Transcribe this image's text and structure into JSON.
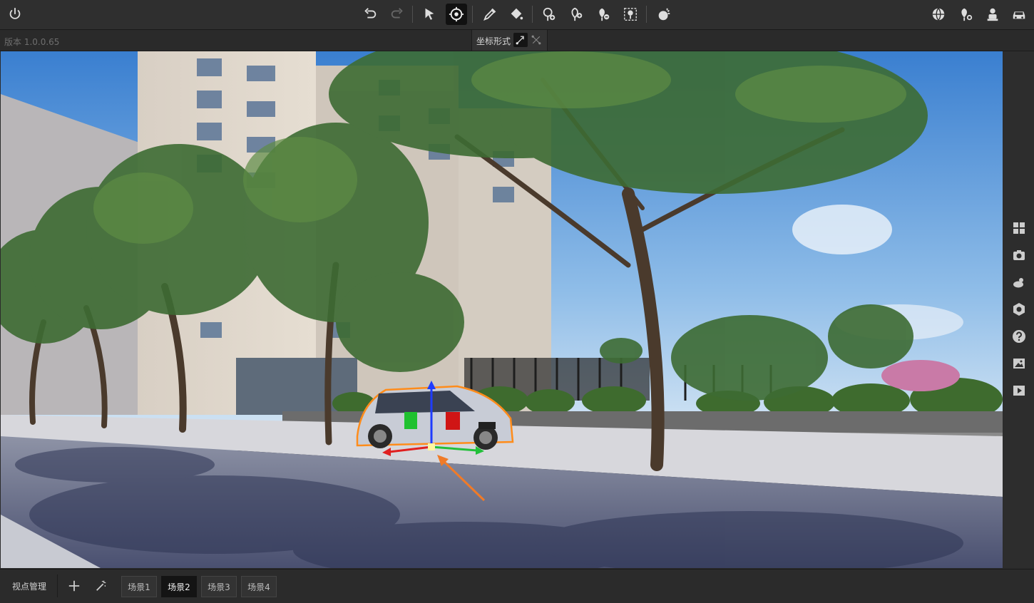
{
  "toolbar": {
    "icons": [
      "power-icon",
      "undo-icon",
      "redo-icon",
      "select-arrow-icon",
      "orbit-icon",
      "eyedropper-icon",
      "paint-bucket-icon",
      "add-tree-icon",
      "add-plant-icon",
      "remove-plant-icon",
      "scatter-plants-icon",
      "weather-icon",
      "globe-icon",
      "tree-settings-icon",
      "person-icon",
      "car-icon"
    ],
    "active": "orbit-icon"
  },
  "subbar": {
    "version": "版本 1.0.0.65",
    "coord_label": "坐标形式"
  },
  "right_panel": {
    "icons": [
      "grid-icon",
      "camera-icon",
      "weather-icon",
      "settings-icon",
      "help-icon",
      "image-icon",
      "play-icon"
    ]
  },
  "bottom": {
    "viewpoint_manage": "视点管理",
    "scenes": [
      "场景1",
      "场景2",
      "场景3",
      "场景4"
    ],
    "active_scene": "场景2"
  },
  "colors": {
    "toolbar_bg": "#2f2f2f",
    "accent_x": "#e02020",
    "accent_y": "#22c03a",
    "accent_z": "#1f3cff",
    "selection_outline": "#ff8c1a"
  }
}
